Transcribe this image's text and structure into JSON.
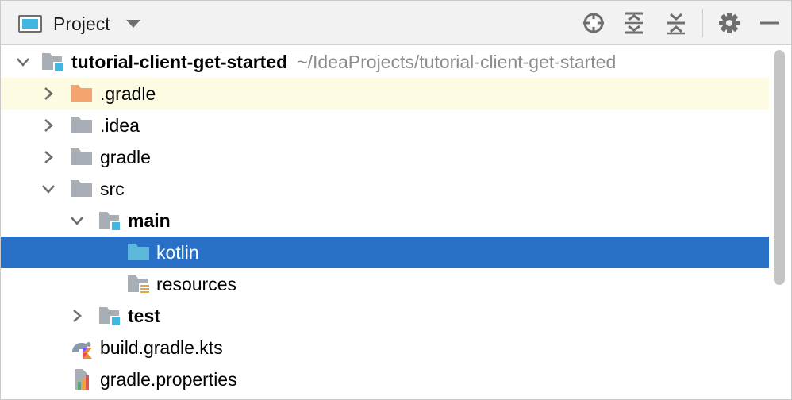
{
  "header": {
    "view_label": "Project",
    "actions": [
      "locate-icon",
      "expand-all-icon",
      "collapse-all-icon",
      "gear-icon",
      "hide-icon"
    ]
  },
  "tree": {
    "root": {
      "name": "tutorial-client-get-started",
      "path": "~/IdeaProjects/tutorial-client-get-started"
    },
    "gradle_dir": ".gradle",
    "idea_dir": ".idea",
    "gradle": "gradle",
    "src": "src",
    "main": "main",
    "kotlin": "kotlin",
    "resources": "resources",
    "test": "test",
    "build_file": "build.gradle.kts",
    "props_file": "gradle.properties"
  },
  "colors": {
    "selection": "#2870c6",
    "highlight_row": "#fdfbe1",
    "excluded_folder": "#f4a56f",
    "plain_folder": "#a7aeb5",
    "source_folder": "#5cb8d8",
    "module_badge": "#40b6e0",
    "resources_badge": "#e8a33d"
  }
}
